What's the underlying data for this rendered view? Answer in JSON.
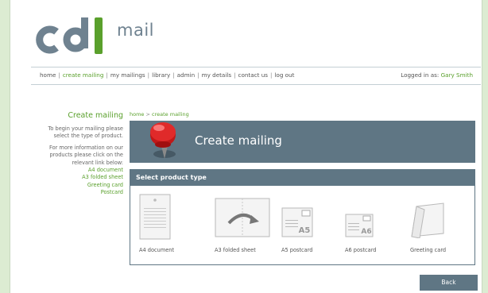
{
  "brand": {
    "logo_text": "cdl",
    "mail_text": "mail"
  },
  "nav": {
    "items": [
      "home",
      "create mailing",
      "my mailings",
      "library",
      "admin",
      "my details",
      "contact us",
      "log out"
    ],
    "active": "create mailing"
  },
  "login": {
    "prefix": "Logged in as:",
    "user": "Gary Smith"
  },
  "sidebar": {
    "title": "Create mailing",
    "intro": "To begin your mailing please select the type of product.",
    "info": "For more information on our products please click on the relevant link below:",
    "links": [
      "A4 document",
      "A3 folded sheet",
      "Greeting card",
      "Postcard"
    ]
  },
  "breadcrumb": {
    "home": "home",
    "sep": ">",
    "current": "create mailing"
  },
  "banner": {
    "title": "Create mailing"
  },
  "product_panel": {
    "title": "Select product type",
    "products": [
      {
        "label": "A4 document"
      },
      {
        "label": "A3 folded sheet"
      },
      {
        "label": "A5 postcard",
        "tag": "A5"
      },
      {
        "label": "A6 postcard",
        "tag": "A6"
      },
      {
        "label": "Greeting card"
      }
    ]
  },
  "actions": {
    "back": "Back"
  },
  "colors": {
    "accent_green": "#5aa02c",
    "slate": "#5f7684",
    "page_bg": "#dcecd2"
  }
}
